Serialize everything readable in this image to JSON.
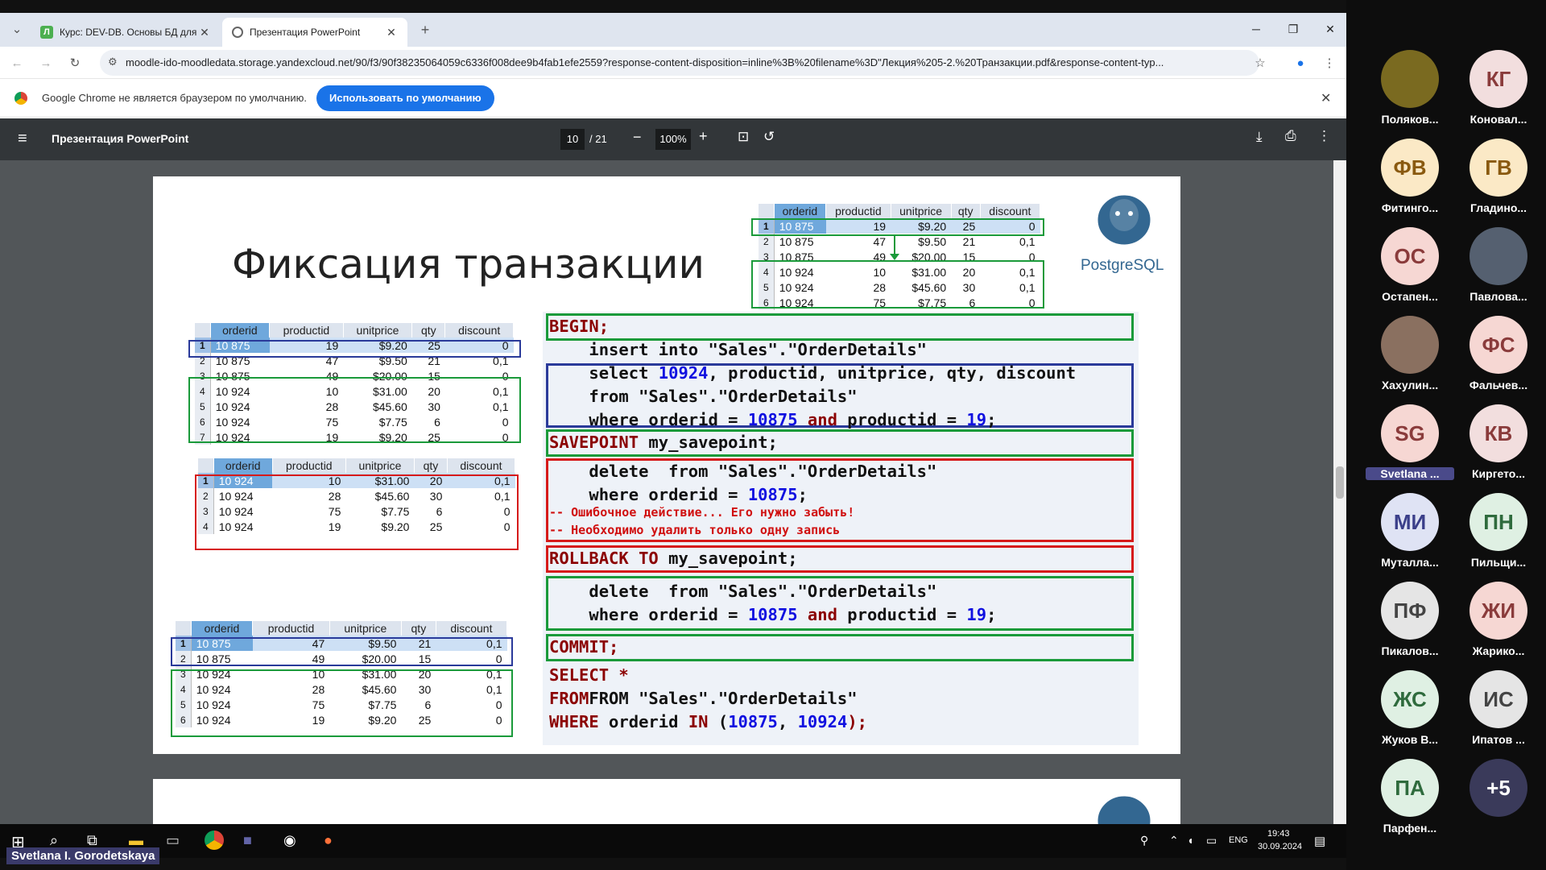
{
  "browser": {
    "tabs": [
      {
        "title": "Курс: DEV-DB. Основы БД для",
        "active": false
      },
      {
        "title": "Презентация PowerPoint",
        "active": true
      }
    ],
    "new_tab": "+",
    "url": "moodle-ido-moodledata.storage.yandexcloud.net/90/f3/90f38235064059c6336f008dee9b4fab1efe2559?response-content-disposition=inline%3B%20filename%3D\"Лекция%205-2.%20Транзакции.pdf&response-content-typ...",
    "infobar_text": "Google Chrome не является браузером по умолчанию.",
    "infobar_button": "Использовать по умолчанию"
  },
  "pdf": {
    "title": "Презентация PowerPoint",
    "page": "10",
    "total": "/ 21",
    "zoom": "100%"
  },
  "slide": {
    "title": "Фиксация транзакции",
    "logo": "PostgreSQL",
    "headers": [
      "orderid",
      "productid",
      "unitprice",
      "qty",
      "discount"
    ],
    "table_top_right": [
      [
        "1",
        "10 875",
        "19",
        "$9.20",
        "25",
        "0"
      ],
      [
        "2",
        "10 875",
        "47",
        "$9.50",
        "21",
        "0,1"
      ],
      [
        "3",
        "10 875",
        "49",
        "$20.00",
        "15",
        "0"
      ],
      [
        "4",
        "10 924",
        "10",
        "$31.00",
        "20",
        "0,1"
      ],
      [
        "5",
        "10 924",
        "28",
        "$45.60",
        "30",
        "0,1"
      ],
      [
        "6",
        "10 924",
        "75",
        "$7.75",
        "6",
        "0"
      ]
    ],
    "table_left1": [
      [
        "1",
        "10 875",
        "19",
        "$9.20",
        "25",
        "0"
      ],
      [
        "2",
        "10 875",
        "47",
        "$9.50",
        "21",
        "0,1"
      ],
      [
        "3",
        "10 875",
        "49",
        "$20.00",
        "15",
        "0"
      ],
      [
        "4",
        "10 924",
        "10",
        "$31.00",
        "20",
        "0,1"
      ],
      [
        "5",
        "10 924",
        "28",
        "$45.60",
        "30",
        "0,1"
      ],
      [
        "6",
        "10 924",
        "75",
        "$7.75",
        "6",
        "0"
      ],
      [
        "7",
        "10 924",
        "19",
        "$9.20",
        "25",
        "0"
      ]
    ],
    "table_left2": [
      [
        "1",
        "10 924",
        "10",
        "$31.00",
        "20",
        "0,1"
      ],
      [
        "2",
        "10 924",
        "28",
        "$45.60",
        "30",
        "0,1"
      ],
      [
        "3",
        "10 924",
        "75",
        "$7.75",
        "6",
        "0"
      ],
      [
        "4",
        "10 924",
        "19",
        "$9.20",
        "25",
        "0"
      ]
    ],
    "table_left3": [
      [
        "1",
        "10 875",
        "47",
        "$9.50",
        "21",
        "0,1"
      ],
      [
        "2",
        "10 875",
        "49",
        "$20.00",
        "15",
        "0"
      ],
      [
        "3",
        "10 924",
        "10",
        "$31.00",
        "20",
        "0,1"
      ],
      [
        "4",
        "10 924",
        "28",
        "$45.60",
        "30",
        "0,1"
      ],
      [
        "5",
        "10 924",
        "75",
        "$7.75",
        "6",
        "0"
      ],
      [
        "6",
        "10 924",
        "19",
        "$9.20",
        "25",
        "0"
      ]
    ],
    "code": {
      "begin": "BEGIN;",
      "insert": "    insert into \"Sales\".\"OrderDetails\"",
      "select1": "    select ",
      "select1_num": "10924",
      "select1_rest": ", productid, unitprice, qty, discount",
      "from1": "    from \"Sales\".\"OrderDetails\"",
      "where1a": "    where orderid = ",
      "where1_num": "10875",
      "where1_and": " and",
      "where1b": " productid = ",
      "where1_num2": "19",
      "savepoint": "SAVEPOINT",
      "savepoint_name": " my_savepoint;",
      "delete1": "    delete  from \"Sales\".\"OrderDetails\"",
      "where2a": "    where orderid = ",
      "where2_num": "10875",
      "comment1": "-- Ошибочное действие... Его нужно забыть!",
      "comment2": "-- Необходимо удалить только одну запись",
      "rollback": "ROLLBACK TO",
      "rollback_name": " my_savepoint;",
      "delete2": "    delete  from \"Sales\".\"OrderDetails\"",
      "where3a": "    where orderid = ",
      "where3_num": "10875",
      "where3_and": " and",
      "where3b": " productid = ",
      "where3_num2": "19",
      "commit": "COMMIT;",
      "sel_a": "SELECT *",
      "from_a": "FROM \"Sales\".\"OrderDetails\"",
      "where_a": "WHERE",
      "where_a_mid": " orderid ",
      "where_a_in": "IN",
      "where_a_open": " (",
      "where_a_n1": "10875",
      "where_a_sep": ", ",
      "where_a_n2": "10924",
      "where_a_close": ");"
    }
  },
  "participants": [
    {
      "initials": "",
      "name": "Поляков...",
      "bg": "#7a6a20",
      "fg": "#fff"
    },
    {
      "initials": "КГ",
      "name": "Коновал...",
      "bg": "#f2dede",
      "fg": "#8a3b3b"
    },
    {
      "initials": "ФВ",
      "name": "Фитинго...",
      "bg": "#fbe9c6",
      "fg": "#8a5a10"
    },
    {
      "initials": "ГВ",
      "name": "Гладино...",
      "bg": "#fbe9c6",
      "fg": "#8a5a10"
    },
    {
      "initials": "ОС",
      "name": "Остапен...",
      "bg": "#f6d7d3",
      "fg": "#8a3b3b"
    },
    {
      "initials": "",
      "name": "Павлова...",
      "bg": "#556070",
      "fg": "#fff"
    },
    {
      "initials": "",
      "name": "Хахулин...",
      "bg": "#8a7060",
      "fg": "#fff"
    },
    {
      "initials": "ФС",
      "name": "Фальчев...",
      "bg": "#f6d7d3",
      "fg": "#8a3b3b"
    },
    {
      "initials": "SG",
      "name": "Svetlana ...",
      "bg": "#f6d7d3",
      "fg": "#8a3b3b"
    },
    {
      "initials": "КВ",
      "name": "Киргето...",
      "bg": "#f2dede",
      "fg": "#8a3b3b"
    },
    {
      "initials": "МИ",
      "name": "Муталла...",
      "bg": "#dfe3f4",
      "fg": "#3b3f8a"
    },
    {
      "initials": "ПН",
      "name": "Пильщи...",
      "bg": "#dff0e3",
      "fg": "#2f6b3d"
    },
    {
      "initials": "ПФ",
      "name": "Пикалов...",
      "bg": "#e5e5e5",
      "fg": "#444"
    },
    {
      "initials": "ЖИ",
      "name": "Жарико...",
      "bg": "#f6d7d3",
      "fg": "#8a3b3b"
    },
    {
      "initials": "ЖС",
      "name": "Жуков В...",
      "bg": "#dff0e3",
      "fg": "#2f6b3d"
    },
    {
      "initials": "ИС",
      "name": "Ипатов ...",
      "bg": "#e5e5e5",
      "fg": "#444"
    },
    {
      "initials": "ПА",
      "name": "Парфен...",
      "bg": "#dff0e3",
      "fg": "#2f6b3d"
    },
    {
      "initials": "+5",
      "name": "",
      "bg": "#3a3a5a",
      "fg": "#fff"
    }
  ],
  "taskbar": {
    "time": "19:43",
    "date": "30.09.2024",
    "lang": "ENG"
  },
  "presenter_name": "Svetlana I. Gorodetskaya"
}
